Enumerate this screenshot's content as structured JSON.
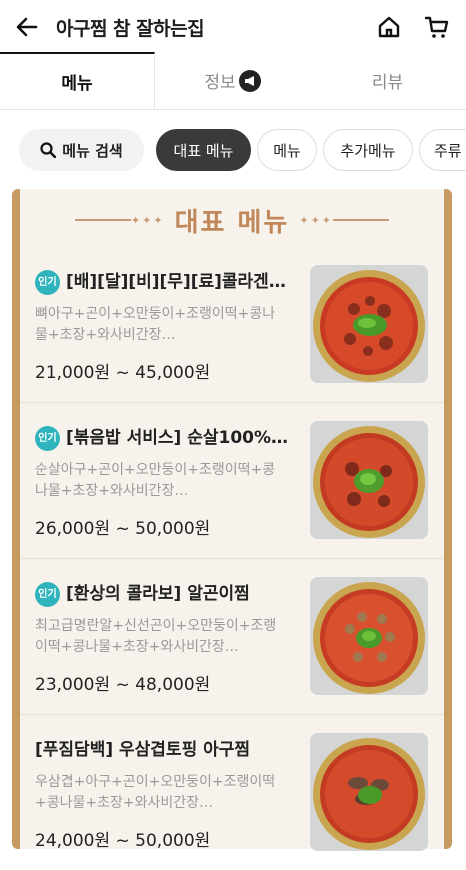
{
  "header": {
    "title": "아구찜 참 잘하는집",
    "back_icon": "arrow-left-icon",
    "home_icon": "home-icon",
    "cart_icon": "cart-icon"
  },
  "tabs": [
    {
      "label": "메뉴",
      "active": true
    },
    {
      "label": "정보",
      "active": false,
      "icon": "megaphone-icon"
    },
    {
      "label": "리뷰",
      "active": false
    }
  ],
  "chips": {
    "search_label": "메뉴 검색",
    "items": [
      "대표 메뉴",
      "메뉴",
      "추가메뉴",
      "주류"
    ]
  },
  "section": {
    "title": "대표 메뉴"
  },
  "menu_items": [
    {
      "badge": "인기",
      "name": "[배][달][비][무][료]콜라겐…",
      "desc_line1": "뼈아구+곤이+오만둥이+조랭이떡+콩나",
      "desc_line2": "물+초장+와사비간장…",
      "price": "21,000원 ~ 45,000원"
    },
    {
      "badge": "인기",
      "name": "[볶음밥 서비스] 순살100%…",
      "desc_line1": "순살아구+곤이+오만둥이+조랭이떡+콩",
      "desc_line2": "나물+초장+와사비간장…",
      "price": "26,000원 ~ 50,000원"
    },
    {
      "badge": "인기",
      "name": "[환상의 콜라보] 알곤이찜",
      "desc_line1": "최고급명란알+신선곤이+오만둥이+조랭",
      "desc_line2": "이떡+콩나물+초장+와사비간장…",
      "price": "23,000원 ~ 48,000원"
    },
    {
      "badge": "",
      "name": "[푸짐담백] 우삼겹토핑 아구찜",
      "desc_line1": "우삼겹+아구+곤이+오만둥이+조랭이떡",
      "desc_line2": "+콩나물+초장+와사비간장…",
      "price": "24,000원 ~ 50,000원"
    }
  ],
  "colors": {
    "badge": "#2fb4bd",
    "board_border": "#c79a62",
    "board_title": "#c0875a",
    "active_chip": "#3a3a3a"
  }
}
